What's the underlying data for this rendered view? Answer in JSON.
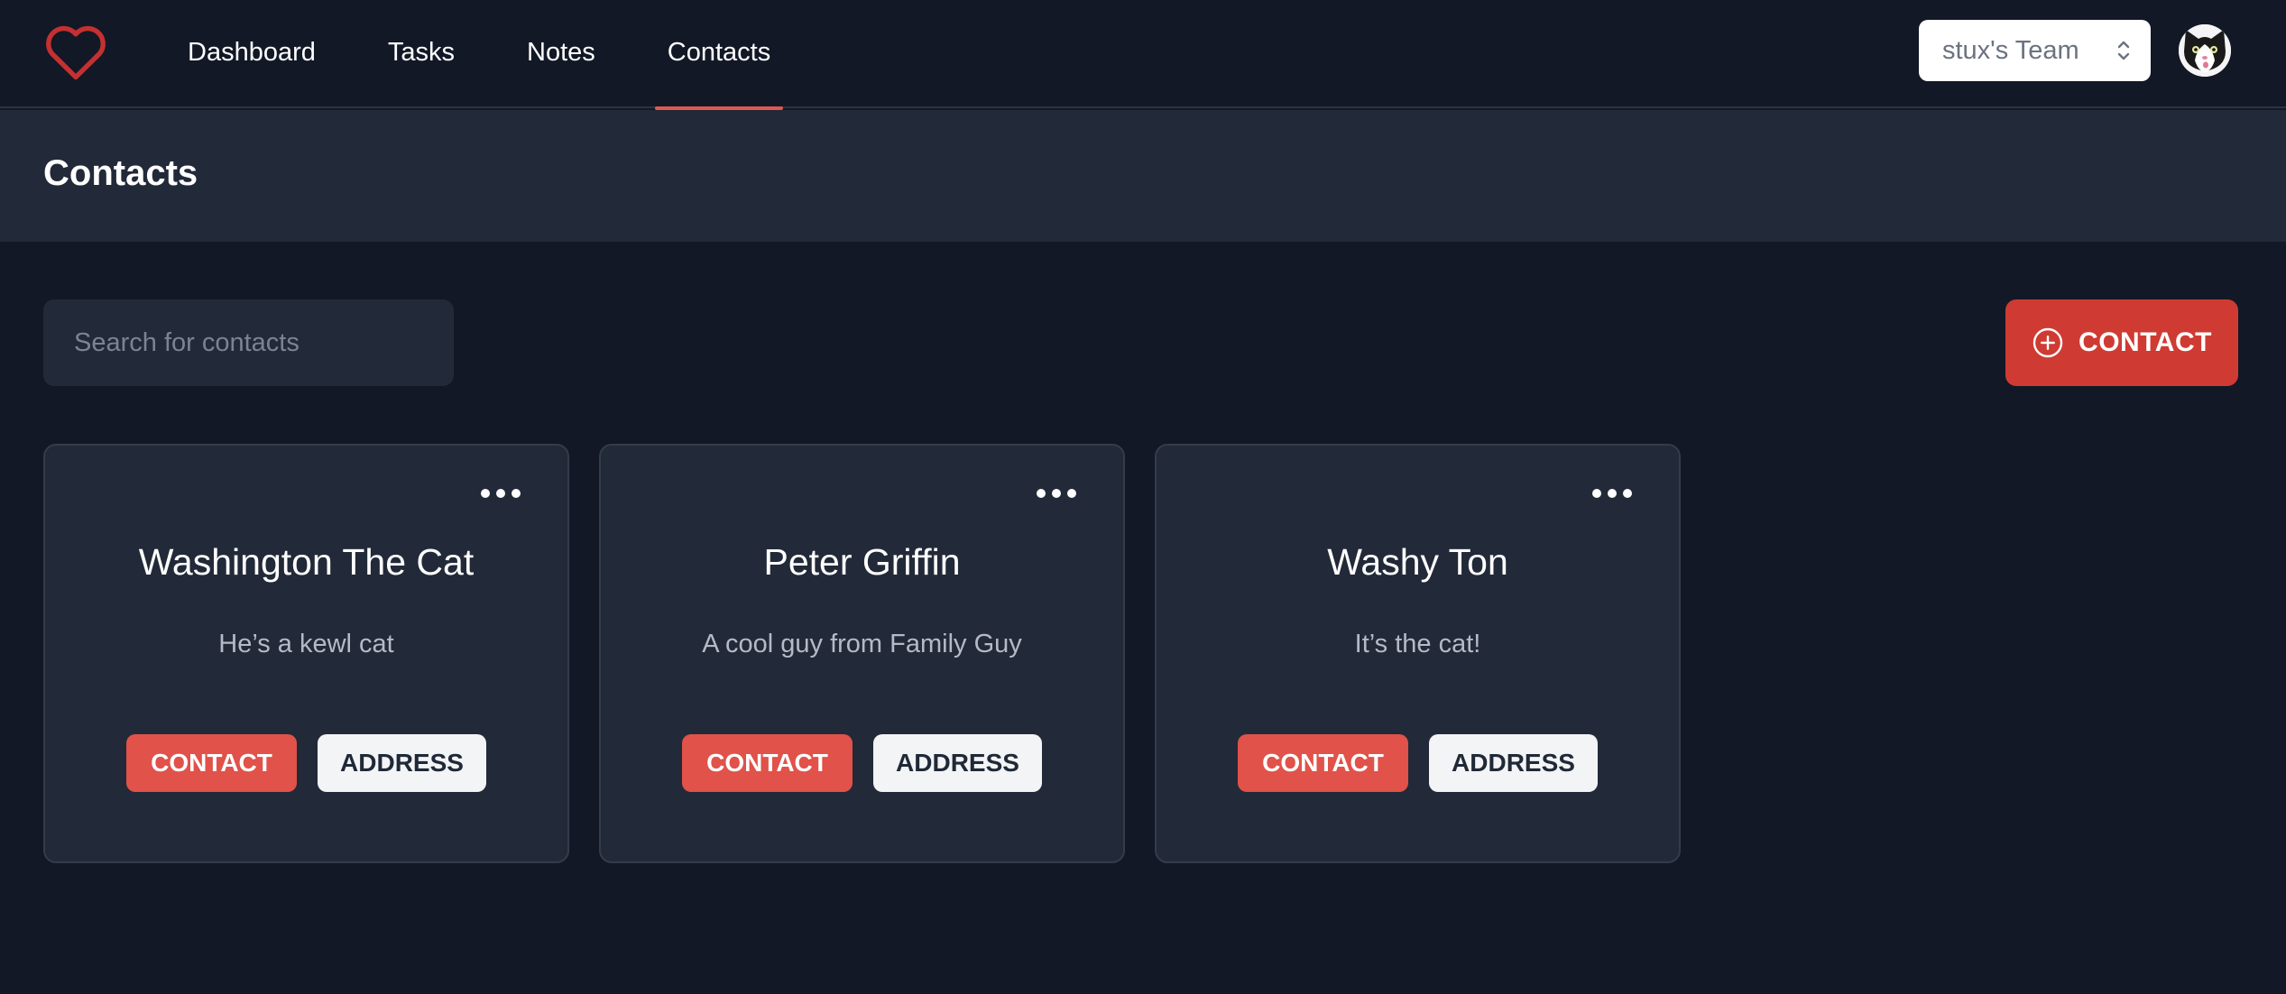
{
  "nav": {
    "links": [
      {
        "label": "Dashboard",
        "active": false
      },
      {
        "label": "Tasks",
        "active": false
      },
      {
        "label": "Notes",
        "active": false
      },
      {
        "label": "Contacts",
        "active": true
      }
    ],
    "team_select": {
      "value": "stux's Team"
    },
    "colors": {
      "accent": "#e0584f",
      "logo": "#c53030"
    }
  },
  "page": {
    "title": "Contacts"
  },
  "toolbar": {
    "search_placeholder": "Search for contacts",
    "add_contact_label": "CONTACT",
    "add_contact_icon": "plus-circle-icon"
  },
  "contacts": [
    {
      "name": "Washington The Cat",
      "description": "He’s a kewl cat",
      "contact_label": "CONTACT",
      "address_label": "ADDRESS"
    },
    {
      "name": "Peter Griffin",
      "description": "A cool guy from Family Guy",
      "contact_label": "CONTACT",
      "address_label": "ADDRESS"
    },
    {
      "name": "Washy Ton",
      "description": "It’s the cat!",
      "contact_label": "CONTACT",
      "address_label": "ADDRESS"
    }
  ]
}
